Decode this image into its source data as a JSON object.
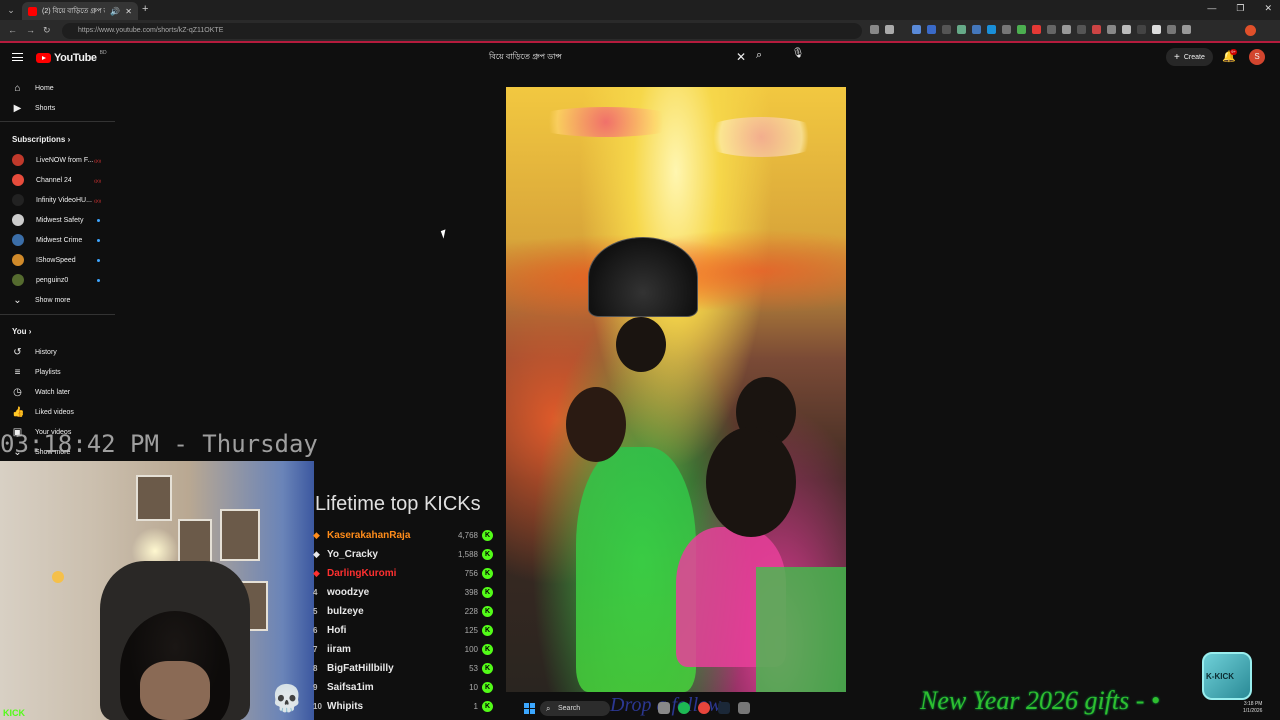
{
  "browser": {
    "tab_title": "(2) বিয়ে বাড়িতে গ্রুপ ডান্স",
    "url": "https://www.youtube.com/shorts/kZ-qZ11OKTE",
    "win_controls": [
      "—",
      "❐",
      "✕"
    ]
  },
  "header": {
    "logo_text": "YouTube",
    "logo_country": "BD",
    "search_query": "বিয়ে বাড়িতে গ্রুপ ডান্স",
    "create_label": "Create",
    "notification_count": "9+",
    "avatar_letter": "S"
  },
  "sidebar": {
    "home": "Home",
    "shorts": "Shorts",
    "subscriptions_heading": "Subscriptions",
    "subscriptions": [
      {
        "name": "LiveNOW from F...",
        "status": "live",
        "color": "#c0392b"
      },
      {
        "name": "Channel 24",
        "status": "live",
        "color": "#e74c3c"
      },
      {
        "name": "Infinity VideoHU...",
        "status": "live",
        "color": "#222222"
      },
      {
        "name": "Midwest Safety",
        "status": "new",
        "color": "#cccccc"
      },
      {
        "name": "Midwest Crime",
        "status": "new",
        "color": "#3b6ea8"
      },
      {
        "name": "IShowSpeed",
        "status": "new",
        "color": "#d08a2a"
      },
      {
        "name": "penguinz0",
        "status": "new",
        "color": "#556b2f"
      }
    ],
    "show_more": "Show more",
    "you_heading": "You",
    "you_items": [
      "History",
      "Playlists",
      "Watch later",
      "Liked videos",
      "Your videos"
    ],
    "show_more_2": "Show more"
  },
  "overlay": {
    "clock": "03:18:42 PM - Thursday",
    "kicks_title": "Lifetime top KICKs",
    "kick_brand": "KICK",
    "leaderboard": [
      {
        "rank": "",
        "name": "KaserakahanRaja",
        "value": "4,768",
        "color": "#ff8c1a",
        "gem": "◆"
      },
      {
        "rank": "",
        "name": "Yo_Cracky",
        "value": "1,588",
        "color": "#e8e8e8",
        "gem": "◆"
      },
      {
        "rank": "",
        "name": "DarlingKuromi",
        "value": "756",
        "color": "#ff3030",
        "gem": "◆"
      },
      {
        "rank": "4",
        "name": "woodzye",
        "value": "398",
        "color": "#e8e8e8",
        "gem": ""
      },
      {
        "rank": "5",
        "name": "bulzeye",
        "value": "228",
        "color": "#e8e8e8",
        "gem": ""
      },
      {
        "rank": "6",
        "name": "Hofi",
        "value": "125",
        "color": "#e8e8e8",
        "gem": ""
      },
      {
        "rank": "7",
        "name": "iiram",
        "value": "100",
        "color": "#e8e8e8",
        "gem": ""
      },
      {
        "rank": "8",
        "name": "BigFatHillbilly",
        "value": "53",
        "color": "#e8e8e8",
        "gem": ""
      },
      {
        "rank": "9",
        "name": "Saifsa1im",
        "value": "10",
        "color": "#e8e8e8",
        "gem": ""
      },
      {
        "rank": "10",
        "name": "Whipits",
        "value": "1",
        "color": "#e8e8e8",
        "gem": ""
      }
    ],
    "gifts_banner": "New Year 2026 gifts - •",
    "follow_banner": "Drop a follow",
    "mascot_label": "K-KICK"
  },
  "taskbar": {
    "search_label": "Search",
    "time": "3:18 PM",
    "date": "1/1/2026"
  }
}
